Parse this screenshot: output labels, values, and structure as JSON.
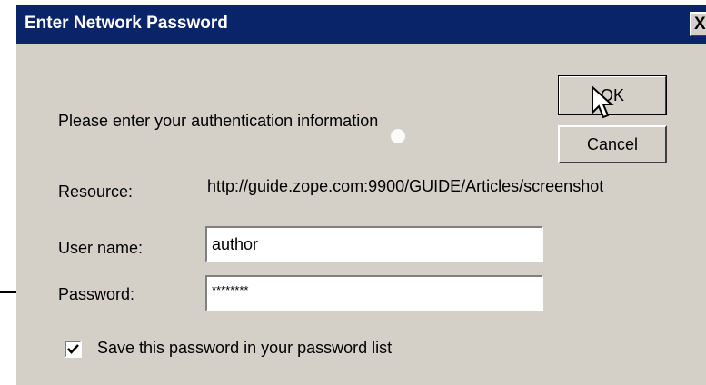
{
  "dialog": {
    "title": "Enter Network Password",
    "close_label": "X",
    "prompt": "Please enter your authentication information",
    "resource_label": "Resource:",
    "resource_value": "http://guide.zope.com:9900/GUIDE/Articles/screenshot",
    "username_label": "User name:",
    "username_value": "author",
    "password_label": "Password:",
    "password_value": "********",
    "save_password_label": "Save this password in your password list",
    "save_password_checked": true
  },
  "buttons": {
    "ok_label": "OK",
    "cancel_label": "Cancel"
  },
  "icons": {
    "close": "close-icon",
    "check": "check-icon",
    "cursor": "mouse-pointer-icon",
    "annotation": "arrow-annotation"
  }
}
